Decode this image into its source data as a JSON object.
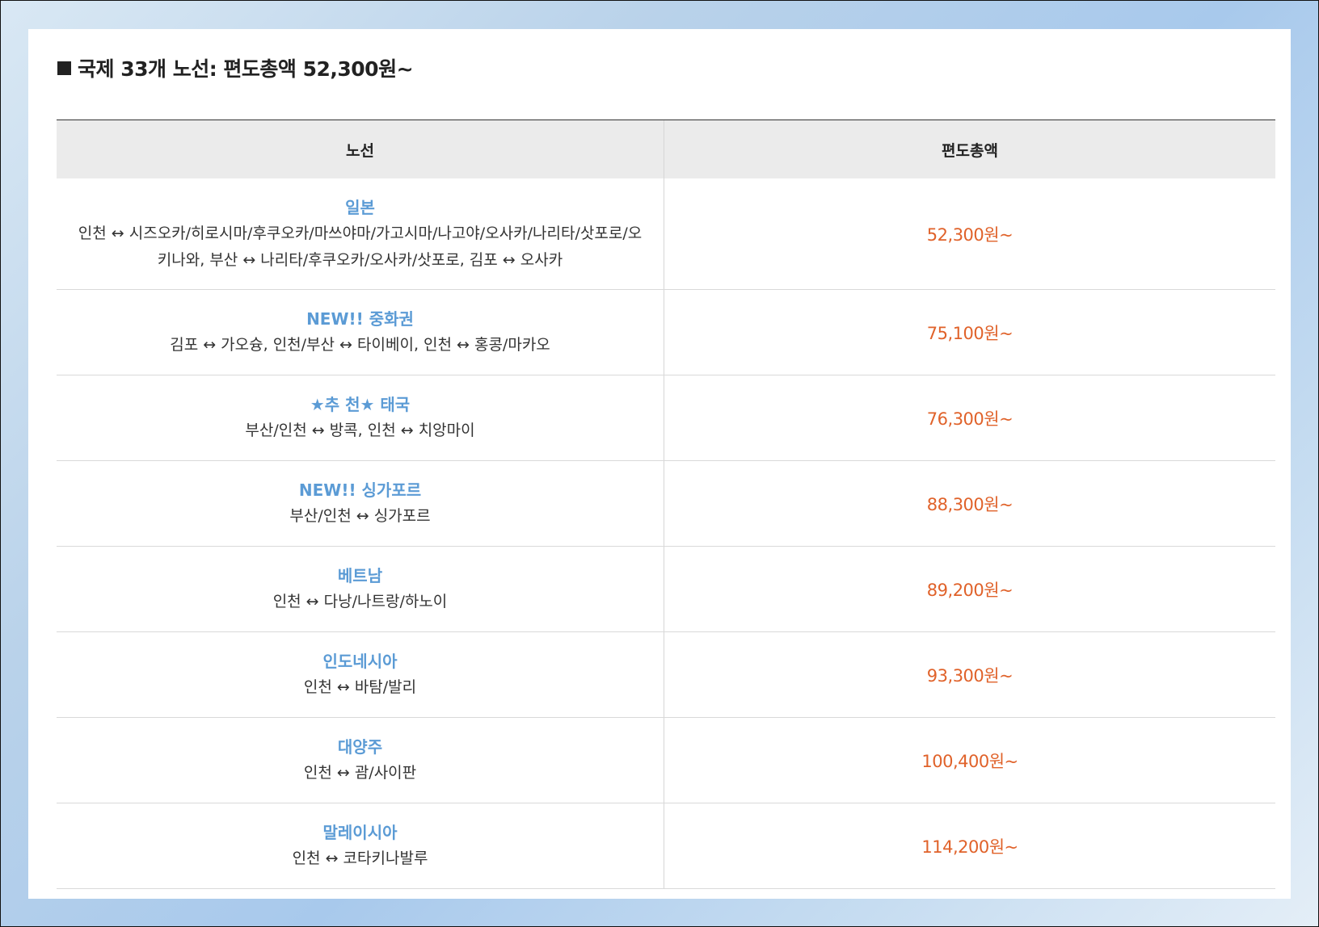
{
  "heading": "국제 33개 노선: 편도총액 52,300원~",
  "table": {
    "headers": {
      "route": "노선",
      "price": "편도총액"
    },
    "rows": [
      {
        "region": "일본",
        "routes": "인천 ↔ 시즈오카/히로시마/후쿠오카/마쓰야마/가고시마/나고야/오사카/나리타/삿포로/오키나와, 부산 ↔ 나리타/후쿠오카/오사카/삿포로, 김포 ↔ 오사카",
        "price": "52,300원~"
      },
      {
        "region": "NEW!! 중화권",
        "routes": "김포 ↔ 가오슝, 인천/부산 ↔ 타이베이, 인천 ↔ 홍콩/마카오",
        "price": "75,100원~"
      },
      {
        "region": "★추 천★ 태국",
        "routes": "부산/인천 ↔ 방콕, 인천 ↔ 치앙마이",
        "price": "76,300원~"
      },
      {
        "region": "NEW!! 싱가포르",
        "routes": "부산/인천 ↔ 싱가포르",
        "price": "88,300원~"
      },
      {
        "region": "베트남",
        "routes": "인천 ↔ 다낭/나트랑/하노이",
        "price": "89,200원~"
      },
      {
        "region": "인도네시아",
        "routes": "인천 ↔ 바탐/발리",
        "price": "93,300원~"
      },
      {
        "region": "대양주",
        "routes": "인천 ↔ 괌/사이판",
        "price": "100,400원~"
      },
      {
        "region": "말레이시아",
        "routes": "인천 ↔ 코타키나발루",
        "price": "114,200원~"
      }
    ]
  }
}
